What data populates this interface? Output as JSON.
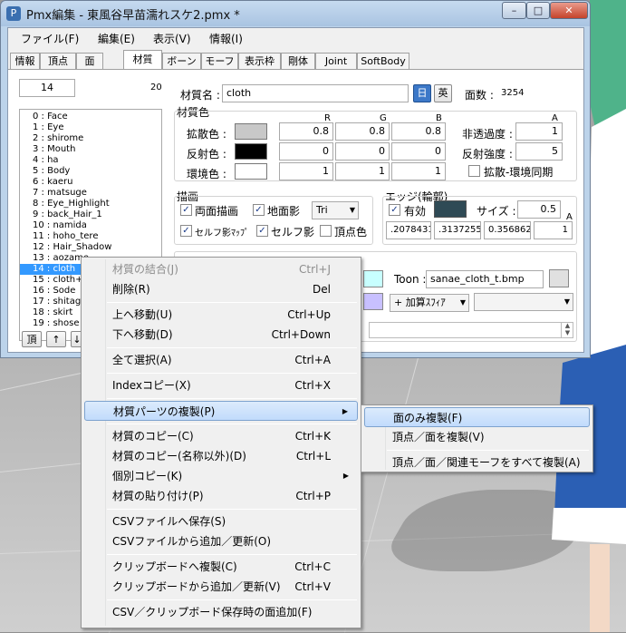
{
  "window": {
    "title": "Pmx編集 - 東風谷早苗濡れスケ2.pmx *",
    "app_icon": "pmx-app-icon"
  },
  "menubar": [
    "ファイル(F)",
    "編集(E)",
    "表示(V)",
    "情報(I)"
  ],
  "tabs": [
    {
      "label": "情報",
      "active": false
    },
    {
      "label": "頂点",
      "active": false
    },
    {
      "label": "面",
      "active": false
    },
    {
      "label": "材質",
      "active": true
    },
    {
      "label": "ボーン",
      "active": false
    },
    {
      "label": "モーフ",
      "active": false
    },
    {
      "label": "表示枠",
      "active": false
    },
    {
      "label": "剛体",
      "active": false
    },
    {
      "label": "Joint",
      "active": false
    },
    {
      "label": "SoftBody",
      "active": false
    }
  ],
  "list": {
    "index_value": "14",
    "count": "20",
    "items": [
      "0 : Face",
      "1 : Eye",
      "2 : shirome",
      "3 : Mouth",
      "4 : ha",
      "5 : Body",
      "6 : kaeru",
      "7 : matsuge",
      "8 : Eye_Highlight",
      "9 : back_Hair_1",
      "10 : namida",
      "11 : hoho_tere",
      "12 : Hair_Shadow",
      "13 : aozame",
      "14 : cloth",
      "15 : cloth+",
      "16 : Sode",
      "17 : shitag",
      "18 : skirt",
      "19 : shose"
    ],
    "selected_index": 14,
    "nav_buttons": [
      "頂",
      "↑",
      "↓"
    ]
  },
  "material": {
    "name_label": "材質名 :",
    "name_value": "cloth",
    "lang_jp": "日",
    "lang_en": "英",
    "face_count_label": "面数 :",
    "face_count": "3254",
    "color_section": "材質色",
    "headers": {
      "r": "R",
      "g": "G",
      "b": "B",
      "a": "A"
    },
    "diffuse": {
      "label": "拡散色 :",
      "r": "0.8",
      "g": "0.8",
      "b": "0.8",
      "color": "#c8c8c8"
    },
    "specular": {
      "label": "反射色 :",
      "r": "0",
      "g": "0",
      "b": "0",
      "color": "#000000"
    },
    "ambient": {
      "label": "環境色 :",
      "r": "1",
      "g": "1",
      "b": "1",
      "color": "#ffffff"
    },
    "alpha_label": "非透過度 :",
    "alpha_value": "1",
    "spec_power_label": "反射強度 :",
    "spec_power_value": "5",
    "sync_label": "拡散-環境同期"
  },
  "drawing": {
    "section": "描画",
    "double_sided": "両面描画",
    "ground_shadow": "地面影",
    "mode_value": "Tri",
    "self_shadow_map": "セルフ影ﾏｯﾌﾟ",
    "self_shadow": "セルフ影",
    "vertex_color": "頂点色"
  },
  "edge": {
    "section": "エッジ(輪郭)",
    "enabled": "有効",
    "color": "#2f4a55",
    "size_label": "サイズ :",
    "size_value": "0.5",
    "a_label": "A",
    "r": ".2078431",
    "g": ".3137255",
    "b": "0.356862",
    "a": "1"
  },
  "texture": {
    "toon_label": "Toon :",
    "toon_value": "sanae_cloth_t.bmp",
    "sphere_mode": "+ 加算ｽﾌｨｱ",
    "tex_color": "#c8ffff",
    "sphere_color": "#c8c0ff"
  },
  "context_menu": {
    "items": [
      {
        "label": "材質の結合(J)",
        "shortcut": "Ctrl+J",
        "disabled": true
      },
      {
        "label": "削除(R)",
        "shortcut": "Del"
      },
      {
        "sep": true
      },
      {
        "label": "上へ移動(U)",
        "shortcut": "Ctrl+Up"
      },
      {
        "label": "下へ移動(D)",
        "shortcut": "Ctrl+Down"
      },
      {
        "sep": true
      },
      {
        "label": "全て選択(A)",
        "shortcut": "Ctrl+A"
      },
      {
        "sep": true
      },
      {
        "label": "Indexコピー(X)",
        "shortcut": "Ctrl+X"
      },
      {
        "sep": true
      },
      {
        "label": "材質パーツの複製(P)",
        "shortcut": "",
        "submenu": true,
        "highlight": true
      },
      {
        "sep": true
      },
      {
        "label": "材質のコピー(C)",
        "shortcut": "Ctrl+K"
      },
      {
        "label": "材質のコピー(名称以外)(D)",
        "shortcut": "Ctrl+L"
      },
      {
        "label": "個別コピー(K)",
        "shortcut": "",
        "submenu": true
      },
      {
        "label": "材質の貼り付け(P)",
        "shortcut": "Ctrl+P"
      },
      {
        "sep": true
      },
      {
        "label": "CSVファイルへ保存(S)",
        "shortcut": ""
      },
      {
        "label": "CSVファイルから追加／更新(O)",
        "shortcut": ""
      },
      {
        "sep": true
      },
      {
        "label": "クリップボードへ複製(C)",
        "shortcut": "Ctrl+C"
      },
      {
        "label": "クリップボードから追加／更新(V)",
        "shortcut": "Ctrl+V"
      },
      {
        "sep": true
      },
      {
        "label": "CSV／クリップボード保存時の面追加(F)",
        "shortcut": ""
      }
    ]
  },
  "submenu": {
    "items": [
      {
        "label": "面のみ複製(F)",
        "highlight": true
      },
      {
        "label": "頂点／面を複製(V)"
      },
      {
        "sep": true
      },
      {
        "label": "頂点／面／関連モーフをすべて複製(A)"
      }
    ]
  }
}
